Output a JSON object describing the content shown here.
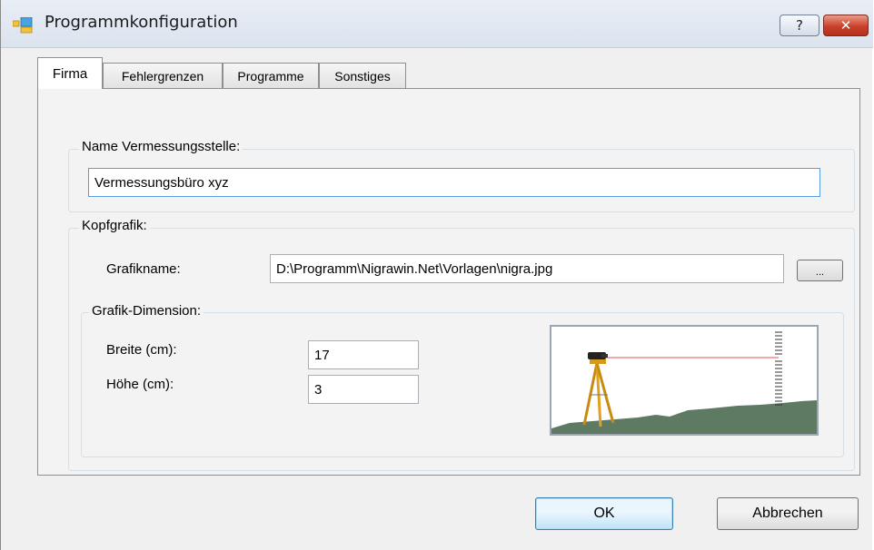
{
  "window": {
    "title": "Programmkonfiguration",
    "help_label": "?",
    "close_label": "✕"
  },
  "tabs": [
    {
      "label": "Firma",
      "active": true
    },
    {
      "label": "Fehlergrenzen",
      "active": false
    },
    {
      "label": "Programme",
      "active": false
    },
    {
      "label": "Sonstiges",
      "active": false
    }
  ],
  "name_group": {
    "label": "Name Vermessungsstelle:",
    "value": "Vermessungsbüro xyz"
  },
  "header_graphic": {
    "label": "Kopfgrafik:",
    "filename_label": "Grafikname:",
    "filename_value": "D:\\Programm\\Nigrawin.Net\\Vorlagen\\nigra.jpg",
    "browse_label": "...",
    "dimension": {
      "label": "Grafik-Dimension:",
      "width_label": "Breite (cm):",
      "width_value": "17",
      "height_label": "Höhe (cm):",
      "height_value": "3"
    },
    "preview_icon": "level-instrument-tripod-image"
  },
  "buttons": {
    "ok_label": "OK",
    "cancel_label": "Abbrechen"
  },
  "colors": {
    "titlebar": "#dbe3ee",
    "close": "#c9402a",
    "focus_border": "#569de5",
    "ground": "#5f7a63",
    "tripod": "#e0a020",
    "laser": "#e05050"
  }
}
